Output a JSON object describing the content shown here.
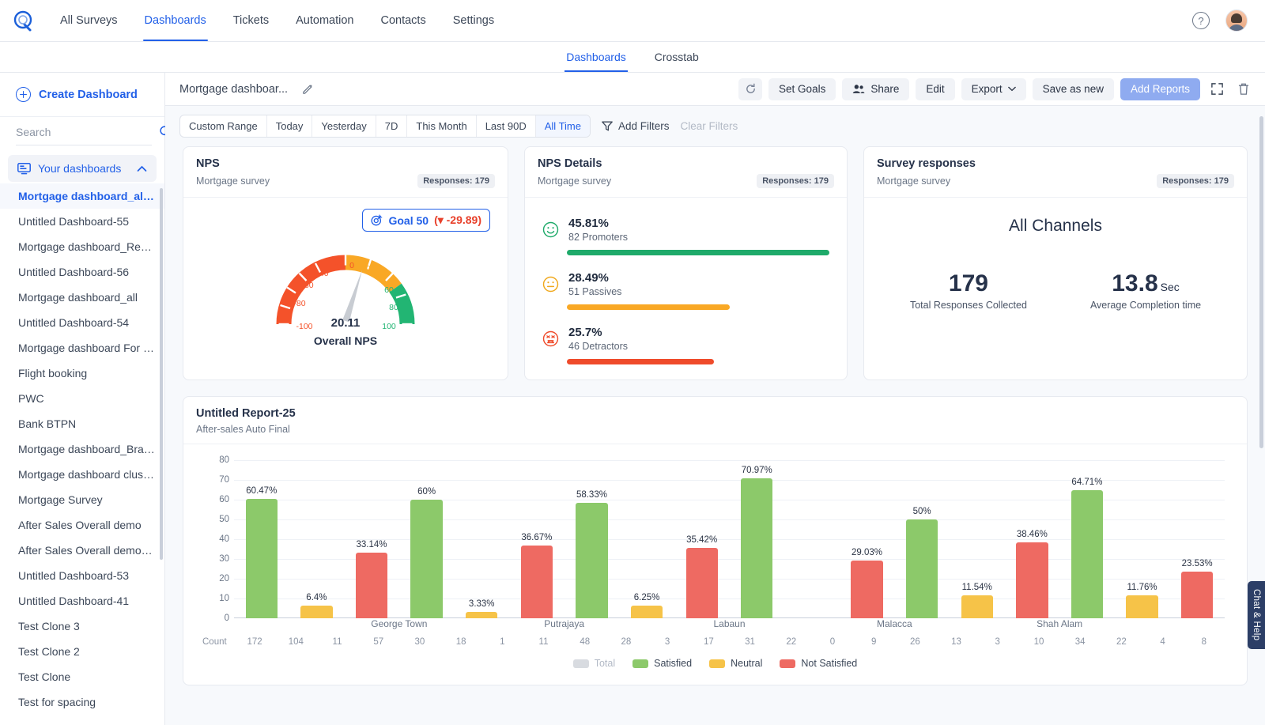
{
  "topnav": {
    "logo_icon": "qualtrics-swirl-logo",
    "links": [
      {
        "label": "All Surveys",
        "active": false
      },
      {
        "label": "Dashboards",
        "active": true
      },
      {
        "label": "Tickets",
        "active": false
      },
      {
        "label": "Automation",
        "active": false
      },
      {
        "label": "Contacts",
        "active": false
      },
      {
        "label": "Settings",
        "active": false
      }
    ],
    "help_label": "?",
    "avatar_icon": "user-avatar"
  },
  "subnav": {
    "tabs": [
      {
        "label": "Dashboards",
        "active": true
      },
      {
        "label": "Crosstab",
        "active": false
      }
    ]
  },
  "sidebar": {
    "create_label": "Create Dashboard",
    "search_placeholder": "Search",
    "search_value": "",
    "group_label": "Your dashboards",
    "items": [
      {
        "label": "Mortgage dashboard_all -...",
        "selected": true
      },
      {
        "label": "Untitled Dashboard-55",
        "selected": false
      },
      {
        "label": "Mortgage dashboard_Regi...",
        "selected": false
      },
      {
        "label": "Untitled Dashboard-56",
        "selected": false
      },
      {
        "label": "Mortgage dashboard_all",
        "selected": false
      },
      {
        "label": "Untitled Dashboard-54",
        "selected": false
      },
      {
        "label": "Mortgage dashboard For R...",
        "selected": false
      },
      {
        "label": "Flight booking",
        "selected": false
      },
      {
        "label": "PWC",
        "selected": false
      },
      {
        "label": "Bank BTPN",
        "selected": false
      },
      {
        "label": "Mortgage dashboard_Bran...",
        "selected": false
      },
      {
        "label": "Mortgage dashboard clust...",
        "selected": false
      },
      {
        "label": "Mortgage Survey",
        "selected": false
      },
      {
        "label": "After Sales Overall demo",
        "selected": false
      },
      {
        "label": "After Sales Overall demo- ...",
        "selected": false
      },
      {
        "label": "Untitled Dashboard-53",
        "selected": false
      },
      {
        "label": "Untitled Dashboard-41",
        "selected": false
      },
      {
        "label": "Test Clone 3",
        "selected": false
      },
      {
        "label": "Test Clone 2",
        "selected": false
      },
      {
        "label": "Test Clone",
        "selected": false
      },
      {
        "label": "Test for spacing",
        "selected": false
      }
    ]
  },
  "toolbar": {
    "dashboard_title": "Mortgage dashboar...",
    "edit_title_icon": "pencil-icon",
    "refresh_icon": "refresh-icon",
    "set_goals": "Set Goals",
    "share": "Share",
    "edit": "Edit",
    "export": "Export",
    "save_as_new": "Save as new",
    "add_reports": "Add Reports",
    "expand_icon": "expand-icon",
    "delete_icon": "trash-icon"
  },
  "filters": {
    "ranges": [
      {
        "label": "Custom Range",
        "active": false
      },
      {
        "label": "Today",
        "active": false
      },
      {
        "label": "Yesterday",
        "active": false
      },
      {
        "label": "7D",
        "active": false
      },
      {
        "label": "This Month",
        "active": false
      },
      {
        "label": "Last 90D",
        "active": false
      },
      {
        "label": "All Time",
        "active": true
      }
    ],
    "add_filters": "Add Filters",
    "clear_filters": "Clear Filters"
  },
  "cards": {
    "nps": {
      "title": "NPS",
      "subtitle": "Mortgage survey",
      "responses_badge": "Responses: 179",
      "goal_label": "Goal 50",
      "goal_delta": "(▾ -29.89)",
      "goal_icon": "target-icon",
      "value": "20.11",
      "value_label": "Overall NPS",
      "needle_value": 20.11,
      "scale_min": -100,
      "scale_max": 100,
      "ticks": [
        "-100",
        "-80",
        "-60",
        "-40",
        "-20",
        "0",
        "20",
        "40",
        "60",
        "80",
        "100"
      ],
      "band_colors": {
        "detractor": "#f4522a",
        "passive": "#f9a825",
        "promoter": "#22b573"
      }
    },
    "nps_details": {
      "title": "NPS Details",
      "subtitle": "Mortgage survey",
      "responses_badge": "Responses: 179",
      "rows": [
        {
          "icon": "smile-face-icon",
          "pct": "45.81%",
          "count": "82 Promoters",
          "bar_pct": 100,
          "color": "#1faa6a"
        },
        {
          "icon": "neutral-face-icon",
          "pct": "28.49%",
          "count": "51 Passives",
          "bar_pct": 62,
          "color": "#f9a825"
        },
        {
          "icon": "sad-face-icon",
          "pct": "25.7%",
          "count": "46 Detractors",
          "bar_pct": 56,
          "color": "#ef4b2b"
        }
      ]
    },
    "survey_responses": {
      "title": "Survey responses",
      "subtitle": "Mortgage survey",
      "responses_badge": "Responses: 179",
      "channel_label": "All Channels",
      "stats": [
        {
          "value": "179",
          "unit": "",
          "label": "Total Responses Collected"
        },
        {
          "value": "13.8",
          "unit": "Sec",
          "label": "Average Completion time"
        }
      ]
    }
  },
  "report": {
    "title": "Untitled Report-25",
    "subtitle": "After-sales Auto Final",
    "count_label": "Count",
    "legend": [
      {
        "label": "Total",
        "color": "#d8dbe0",
        "dim": true
      },
      {
        "label": "Satisfied",
        "color": "#8cc96a",
        "dim": false
      },
      {
        "label": "Neutral",
        "color": "#f6c348",
        "dim": false
      },
      {
        "label": "Not Satisfied",
        "color": "#ee6a62",
        "dim": false
      }
    ]
  },
  "chart_data": {
    "type": "bar",
    "title": "Untitled Report-25",
    "subtitle": "After-sales Auto Final",
    "xlabel": "",
    "ylabel": "",
    "ylim": [
      0,
      80
    ],
    "yticks": [
      0,
      10,
      20,
      30,
      40,
      50,
      60,
      70,
      80
    ],
    "grid": true,
    "legend_position": "bottom",
    "group_labels": [
      "George Town",
      "Putrajaya",
      "Labaun",
      "Malacca",
      "Shah Alam"
    ],
    "series": [
      {
        "name": "Satisfied",
        "color": "#8cc96a"
      },
      {
        "name": "Neutral",
        "color": "#f6c348"
      },
      {
        "name": "Not Satisfied",
        "color": "#ee6a62"
      }
    ],
    "bars": [
      {
        "group": 0,
        "series": "Satisfied",
        "value": 60.47,
        "label": "60.47%",
        "count": 104
      },
      {
        "group": 0,
        "series": "Neutral",
        "value": 6.4,
        "label": "6.4%",
        "count": 11
      },
      {
        "group": 0,
        "series": "Not Satisfied",
        "value": 33.14,
        "label": "33.14%",
        "count": 57
      },
      {
        "group": 1,
        "series": "Satisfied",
        "value": 60,
        "label": "60%",
        "count": 18
      },
      {
        "group": 1,
        "series": "Neutral",
        "value": 3.33,
        "label": "3.33%",
        "count": 1
      },
      {
        "group": 1,
        "series": "Not Satisfied",
        "value": 36.67,
        "label": "36.67%",
        "count": 11
      },
      {
        "group": 2,
        "series": "Satisfied",
        "value": 58.33,
        "label": "58.33%",
        "count": 28
      },
      {
        "group": 2,
        "series": "Neutral",
        "value": 6.25,
        "label": "6.25%",
        "count": 3
      },
      {
        "group": 2,
        "series": "Not Satisfied",
        "value": 35.42,
        "label": "35.42%",
        "count": 17
      },
      {
        "group": 3,
        "series": "Satisfied",
        "value": 70.97,
        "label": "70.97%",
        "count": 22
      },
      {
        "group": 3,
        "series": "Neutral",
        "value": 0,
        "label": "",
        "count": 0
      },
      {
        "group": 3,
        "series": "Not Satisfied",
        "value": 29.03,
        "label": "29.03%",
        "count": 9
      },
      {
        "group": 4,
        "series": "Satisfied",
        "value": 50,
        "label": "50%",
        "count": 13
      },
      {
        "group": 4,
        "series": "Neutral",
        "value": 11.54,
        "label": "11.54%",
        "count": 3
      },
      {
        "group": 4,
        "series": "Not Satisfied",
        "value": 38.46,
        "label": "38.46%",
        "count": 10
      },
      {
        "group": 5,
        "series": "Satisfied",
        "value": 64.71,
        "label": "64.71%",
        "count": 22
      },
      {
        "group": 5,
        "series": "Neutral",
        "value": 11.76,
        "label": "11.76%",
        "count": 4
      },
      {
        "group": 5,
        "series": "Not Satisfied",
        "value": 23.53,
        "label": "23.53%",
        "count": 8
      }
    ],
    "count_row_label": "Count",
    "counts": [
      172,
      104,
      11,
      57,
      30,
      18,
      1,
      11,
      48,
      28,
      3,
      17,
      31,
      22,
      0,
      9,
      26,
      13,
      3,
      10,
      34,
      22,
      4,
      8
    ]
  },
  "help_tab": {
    "label": "Chat & Help"
  }
}
